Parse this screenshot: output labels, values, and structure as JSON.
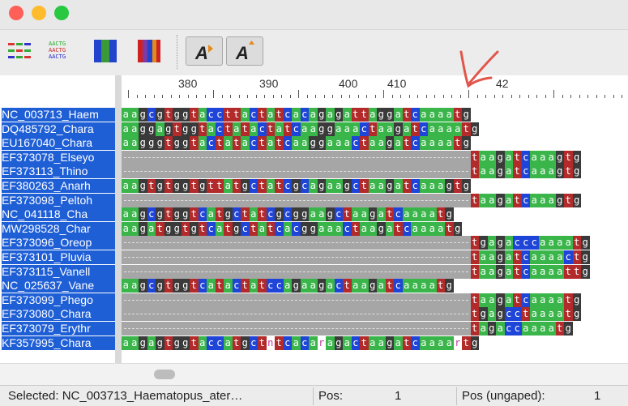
{
  "window": {
    "controls": [
      "close",
      "minimize",
      "zoom"
    ]
  },
  "toolbar": {
    "buttons": [
      "color-nucleotides",
      "color-by-consensus",
      "color-blocks-blue",
      "color-blocks-multi",
      "font-smaller",
      "font-larger"
    ]
  },
  "ruler": {
    "labels": [
      "380",
      "390",
      "400",
      "410",
      "42"
    ]
  },
  "sequences": [
    {
      "name": "NC_003713_Haem",
      "seq": "aagcgtggtaccttactatcacagagattaggatcaaaatg"
    },
    {
      "name": "DQ485792_Chara",
      "seq": "aaggagtggtactatactatcaaggaaactaagatcaaaatg"
    },
    {
      "name": "EU167040_Chara",
      "seq": "aagggtggtactatactatcaaggaaactaagatcaaaatg"
    },
    {
      "name": "EF373078_Elseyo",
      "seq": "-----------------------------------------taagatcaaagtg"
    },
    {
      "name": "EF373113_Thino",
      "seq": "-----------------------------------------taagatcaaagtg"
    },
    {
      "name": "EF380263_Anarh",
      "seq": "aagtgtggtgttatgctatcgcagaagctaagatcaaagtg"
    },
    {
      "name": "EF373098_Peltoh",
      "seq": "-----------------------------------------taagatcaaagtg"
    },
    {
      "name": "NC_041118_Cha",
      "seq": "aagcgtggtcatgctatcgcggaagctaagatcaaaatg"
    },
    {
      "name": "MW298528_Char",
      "seq": "aagatggtgtcatgctatcacggaaactaagatcaaaatg"
    },
    {
      "name": "EF373096_Oreop",
      "seq": "-----------------------------------------tgagacccaaaatg"
    },
    {
      "name": "EF373101_Pluvia",
      "seq": "-----------------------------------------taagatcaaaactg"
    },
    {
      "name": "EF373115_Vanell",
      "seq": "-----------------------------------------taagatcaaaattg"
    },
    {
      "name": "NC_025637_Vane",
      "seq": "aagcgtggtcatactatccagaagactaagatcaaaatg"
    },
    {
      "name": "EF373099_Phego",
      "seq": "-----------------------------------------taagatcaaaatg"
    },
    {
      "name": "EF373080_Chara",
      "seq": "-----------------------------------------tgagcctaaaatg"
    },
    {
      "name": "EF373079_Erythr",
      "seq": "-----------------------------------------tagaccaaaatg"
    },
    {
      "name": "KF357995_Chara",
      "seq": "aagagtggtaccatgctntcacaragactaagatcaaaartg"
    }
  ],
  "status": {
    "selected": "Selected: NC_003713_Haematopus_ater…",
    "pos_label": "Pos:",
    "pos_value": "1",
    "pos_ungaped_label": "Pos (ungaped):",
    "pos_ungaped_value": "1"
  },
  "colors": {
    "a": "#39b54a",
    "c": "#1f44d8",
    "g": "#3a3a3a",
    "t": "#b22a2a",
    "gap": "#a6a6a6",
    "selection": "#1f5fd6",
    "annotation": "#e2554a"
  }
}
